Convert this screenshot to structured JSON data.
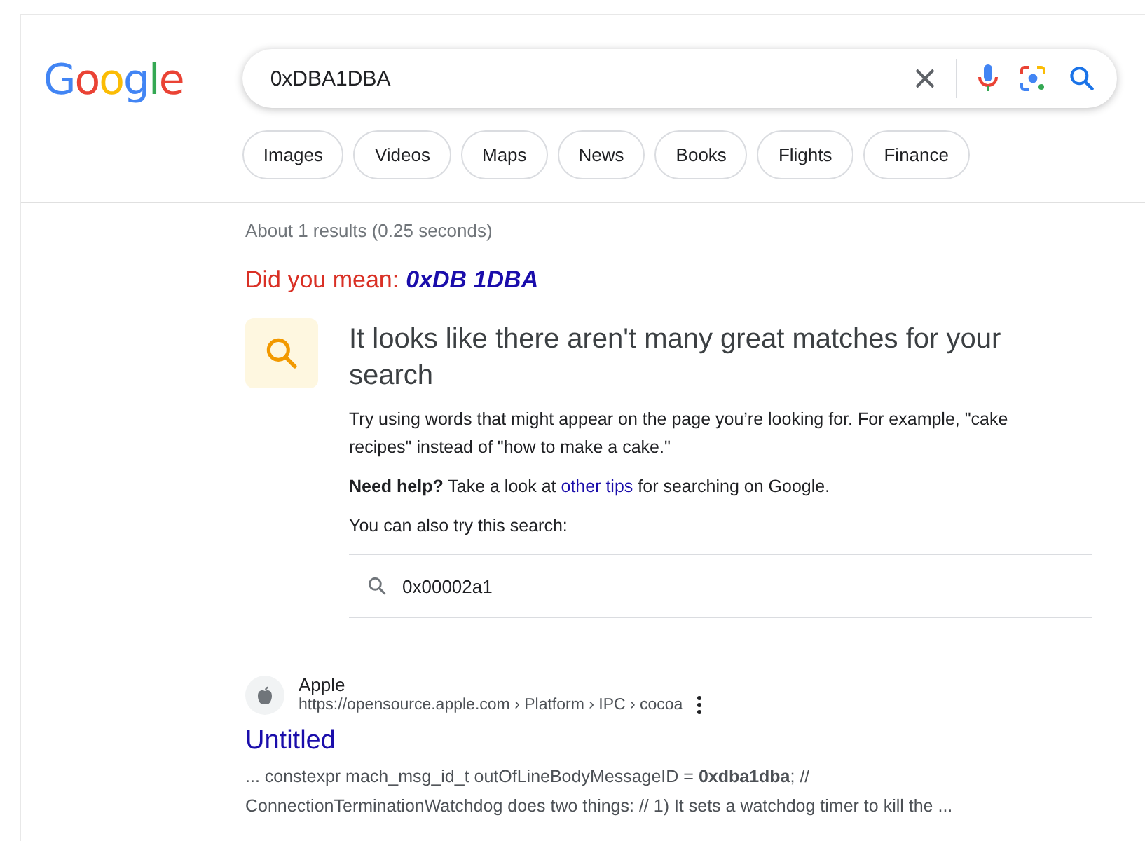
{
  "logo": "Google",
  "search": {
    "value": "0xDBA1DBA"
  },
  "chips": [
    "Images",
    "Videos",
    "Maps",
    "News",
    "Books",
    "Flights",
    "Finance"
  ],
  "stats": "About 1 results (0.25 seconds)",
  "did_you_mean": {
    "label": "Did you mean:",
    "suggestion": "0xDB 1DBA"
  },
  "notice": {
    "heading": "It looks like there aren't many great matches for your search",
    "tip": "Try using words that might appear on the page you’re looking for. For example, \"cake recipes\" instead of \"how to make a cake.\"",
    "help_lead": "Need help?",
    "help_before": "Take a look at",
    "help_link": "other tips",
    "help_after": "for searching on Google.",
    "also_try": "You can also try this search:",
    "suggested_search": "0x00002a1"
  },
  "result": {
    "site": "Apple",
    "url": "https://opensource.apple.com › Platform › IPC › cocoa",
    "title": "Untitled",
    "snippet": "... constexpr mach_msg_id_t outOfLineBodyMessageID = **0xdba1dba**; // ConnectionTerminationWatchdog does two things: // 1) It sets a watchdog timer to kill the ..."
  }
}
